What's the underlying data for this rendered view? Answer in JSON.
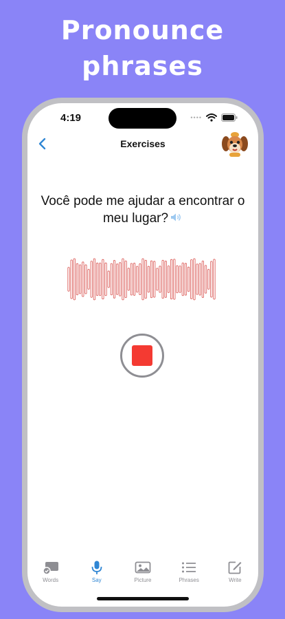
{
  "headline": {
    "line1": "Pronounce",
    "line2": "phrases"
  },
  "status_bar": {
    "time": "4:19"
  },
  "nav": {
    "title": "Exercises"
  },
  "exercise": {
    "phrase": "Você pode me ajudar a encontrar o meu lugar?"
  },
  "tabs": [
    {
      "label": "Words",
      "icon": "cards-icon",
      "active": false
    },
    {
      "label": "Say",
      "icon": "microphone-icon",
      "active": true
    },
    {
      "label": "Picture",
      "icon": "photo-icon",
      "active": false
    },
    {
      "label": "Phrases",
      "icon": "list-icon",
      "active": false
    },
    {
      "label": "Write",
      "icon": "compose-icon",
      "active": false
    }
  ],
  "colors": {
    "background": "#8a84f7",
    "accent": "#2f86d4",
    "record": "#f43a32",
    "waveform": "#d9534f"
  }
}
